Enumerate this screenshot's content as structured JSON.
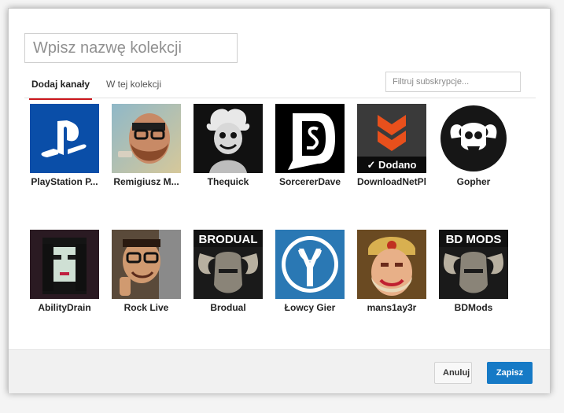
{
  "dialog": {
    "name_placeholder": "Wpisz nazwę kolekcji",
    "tabs": [
      {
        "label": "Dodaj kanały",
        "active": true
      },
      {
        "label": "W tej kolekcji",
        "active": false
      }
    ],
    "filter_placeholder": "Filtruj subskrypcje...",
    "accent_color": "#cc181e",
    "channels": [
      {
        "name": "PlayStation P...",
        "icon": "playstation-logo"
      },
      {
        "name": "Remigiusz M...",
        "icon": "bearded-man-photo"
      },
      {
        "name": "Thequick",
        "icon": "einstein-caricature"
      },
      {
        "name": "SorcererDave",
        "icon": "sd-monogram-logo"
      },
      {
        "name": "DownloadNetPl",
        "icon": "orange-chevron-logo",
        "added_label": "✓ Dodano"
      },
      {
        "name": "Gopher",
        "icon": "ram-skull-logo"
      },
      {
        "name": "AbilityDrain",
        "icon": "pixel-art-woman"
      },
      {
        "name": "Rock Live",
        "icon": "man-with-glasses-photo"
      },
      {
        "name": "Brodual",
        "icon": "skyrim-helmet-brodual",
        "banner": "BRODUAL"
      },
      {
        "name": "Łowcy Gier",
        "icon": "slingshot-logo"
      },
      {
        "name": "mans1ay3r",
        "icon": "warrior-portrait"
      },
      {
        "name": "BDMods",
        "icon": "skyrim-helmet-bdmods",
        "banner": "BD MODS"
      }
    ],
    "footer": {
      "cancel_label": "Anuluj",
      "save_label": "Zapisz",
      "save_color": "#167ac6"
    }
  }
}
